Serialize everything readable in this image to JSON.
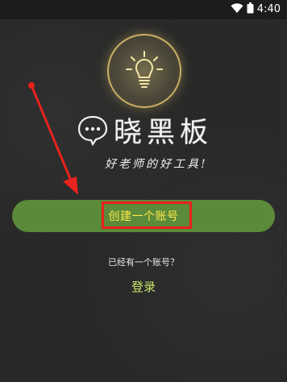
{
  "status_bar": {
    "time": "4:40",
    "icons": [
      "wifi-icon",
      "battery-icon"
    ]
  },
  "logo": {
    "icon": "light-bulb-icon",
    "glow_color": "#ffdc78"
  },
  "brand": {
    "bubble_icon": "chat-bubble-icon",
    "name": "晓黑板",
    "tagline": "好老师的好工具!"
  },
  "actions": {
    "create_account": "创建一个账号",
    "already_have_account": "已经有一个账号？",
    "login": "登录"
  },
  "annotation": {
    "highlight_color": "#e8221e",
    "arrow_color": "#e8221e"
  },
  "colors": {
    "background": "#272727",
    "button": "#5b8a3a",
    "button_text": "#ffe94a",
    "login_text": "#c9e86a"
  }
}
